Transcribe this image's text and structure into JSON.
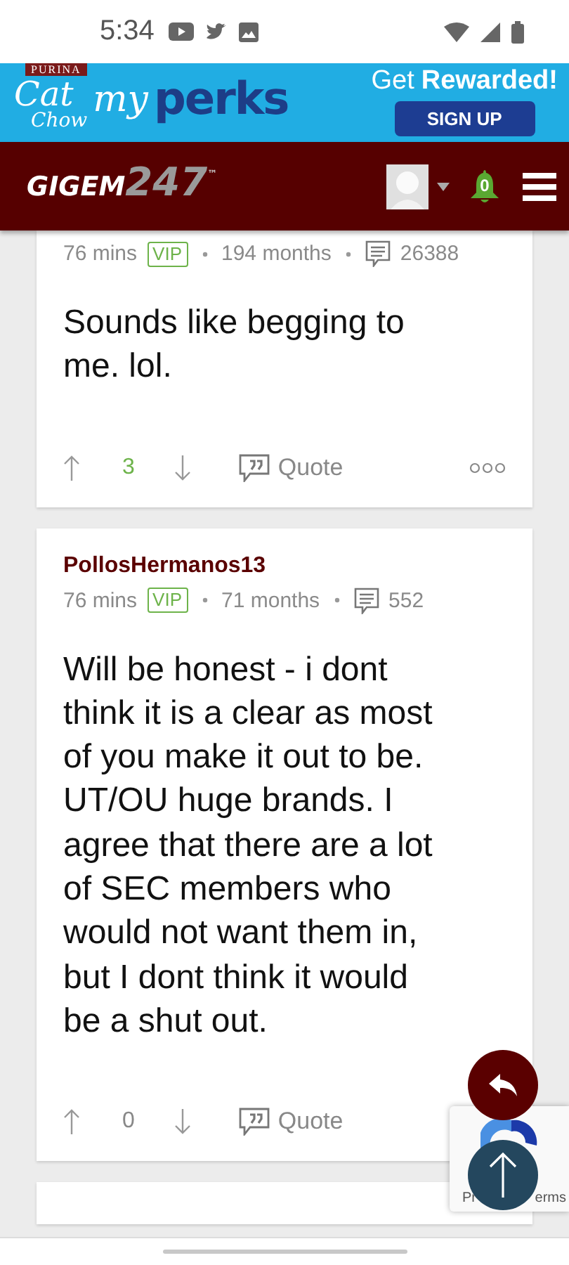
{
  "status_bar": {
    "time": "5:34"
  },
  "ad": {
    "brand": "PURINA",
    "logo_top": "Cat",
    "logo_bottom": "Chow",
    "program_prefix": "my",
    "program": "perks",
    "headline_prefix": "Get",
    "headline": "Rewarded!",
    "button": "SIGN UP"
  },
  "header": {
    "logo_main": "GIGEM",
    "logo_number": "247",
    "logo_mark": "™",
    "notifications": "0"
  },
  "posts": [
    {
      "age": "76 mins",
      "badge": "VIP",
      "tenure": "194 months",
      "post_count": "26388",
      "body": "Sounds like begging to me. lol.",
      "votes": "3",
      "score_positive": true,
      "quote": "Quote",
      "more_menu": true
    },
    {
      "author": "PollosHermanos13",
      "age": "76 mins",
      "badge": "VIP",
      "tenure": "71 months",
      "post_count": "552",
      "body": "Will be honest - i dont think it is a clear as most of you make it out to be. UT/OU huge brands. I agree that there are a lot of SEC members who would not want them in, but I dont think it would be a shut out.",
      "votes": "0",
      "score_positive": false,
      "quote": "Quote",
      "more_menu": false
    }
  ],
  "recaptcha": {
    "left_text": "Pr",
    "right_text": "erms"
  }
}
